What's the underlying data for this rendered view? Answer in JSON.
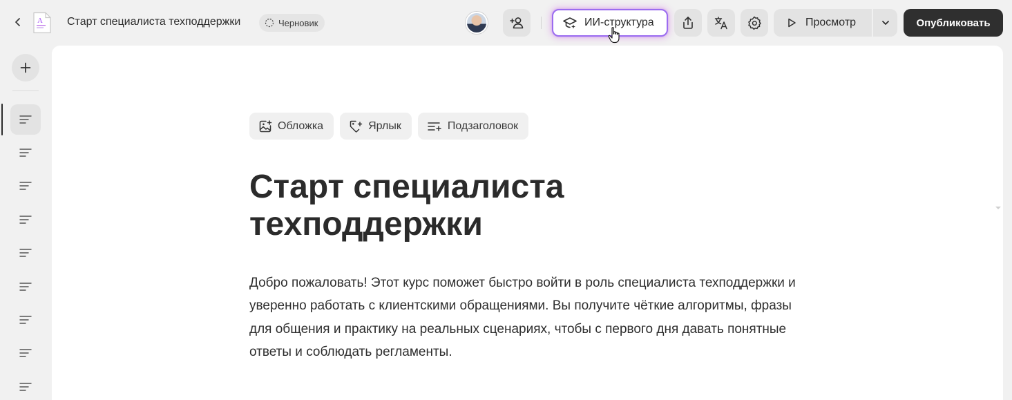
{
  "header": {
    "doc_title": "Старт специалиста техподдержки",
    "status_label": "Черновик",
    "ai_structure_label": "ИИ-структура",
    "preview_label": "Просмотр",
    "publish_label": "Опубликовать"
  },
  "doc_icon_letter": "A",
  "icons": {
    "back": "chevron-left-icon",
    "status": "dashed-circle-icon",
    "invite": "add-user-icon",
    "ai": "graduation-cap-sparkle-icon",
    "share": "share-upload-icon",
    "translate": "translate-icon",
    "settings": "gear-icon",
    "preview": "play-icon",
    "dropdown": "chevron-down-icon",
    "add": "plus-icon",
    "section": "text-lines-icon"
  },
  "sidebar": {
    "items": [
      {
        "active": true
      },
      {
        "active": false
      },
      {
        "active": false
      },
      {
        "active": false
      },
      {
        "active": false
      },
      {
        "active": false
      },
      {
        "active": false
      },
      {
        "active": false
      },
      {
        "active": false
      }
    ]
  },
  "toolbar": {
    "cover_label": "Обложка",
    "label_label": "Ярлык",
    "subtitle_label": "Подзаголовок"
  },
  "content": {
    "title": "Старт специалиста техподдержки",
    "intro": "Добро пожаловать! Этот курс поможет быстро войти в роль специалиста техподдержки и уверенно работать с клиентскими обращениями. Вы получите чёткие алгоритмы, фразы для общения и практику на реальных сценариях, чтобы с первого дня давать понятные ответы и соблюдать регламенты."
  },
  "colors": {
    "background": "#f1f1f1",
    "panel": "#ffffff",
    "button": "#e3e3e3",
    "publish": "#2f2f2f",
    "ai_border": "#9b6cf0",
    "ai_glow": "#d678e6",
    "doc_accent": "#a855f7"
  }
}
